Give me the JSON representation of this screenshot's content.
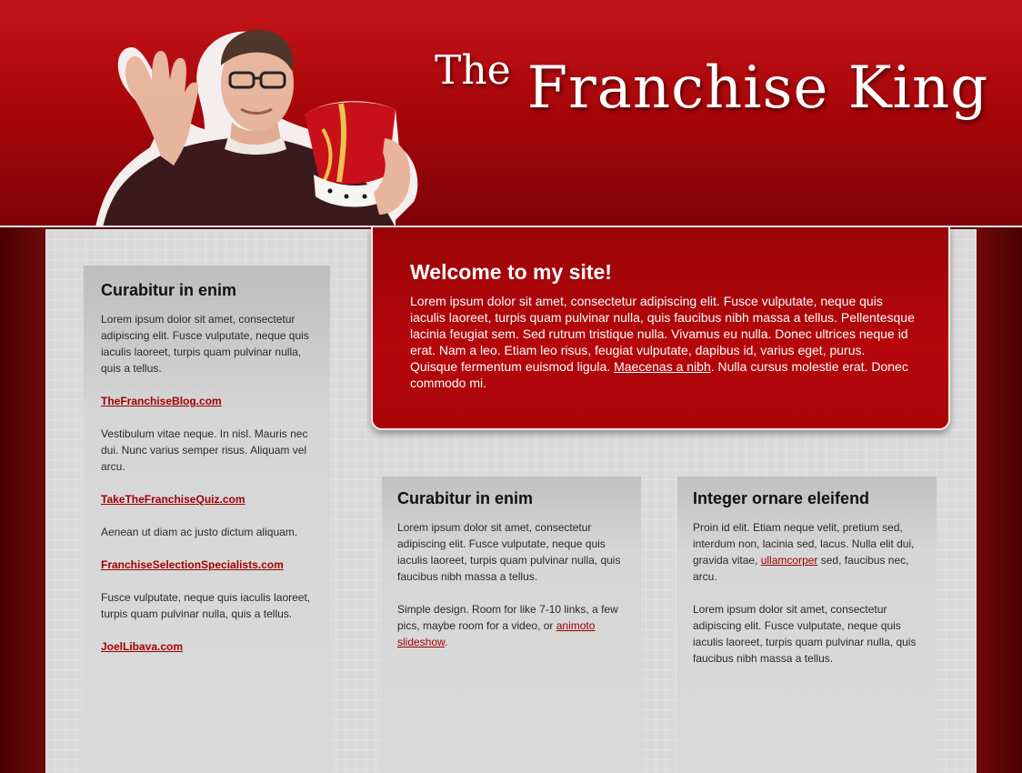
{
  "header": {
    "title_the": "The",
    "title_main": "Franchise King"
  },
  "welcome": {
    "heading": "Welcome to my site!",
    "text_before_link": "Lorem ipsum dolor sit amet, consectetur adipiscing elit. Fusce vulputate, neque quis iaculis laoreet, turpis quam pulvinar nulla, quis faucibus nibh massa a tellus. Pellentesque lacinia feugiat sem. Sed rutrum tristique nulla. Vivamus eu nulla. Donec ultrices neque id erat. Nam a leo. Etiam leo risus, feugiat vulputate, dapibus id, varius eget, purus. Quisque fermentum euismod ligula. ",
    "link_label": "Maecenas a nibh",
    "text_after_link": ". Nulla cursus molestie erat. Donec commodo mi."
  },
  "sidebar": {
    "title": "Curabitur in enim",
    "intro": "Lorem ipsum dolor sit amet, consectetur adipiscing elit. Fusce vulputate, neque quis iaculis laoreet, turpis quam pulvinar nulla, quis a tellus.",
    "link1": "TheFranchiseBlog.com",
    "text1": "Vestibulum vitae neque. In nisl. Mauris nec dui. Nunc varius semper risus. Aliquam vel arcu.",
    "link2": "TakeTheFranchiseQuiz.com",
    "text2": "Aenean ut diam ac justo dictum aliquam.",
    "link3": "FranchiseSelectionSpecialists.com",
    "text3": "Fusce vulputate, neque quis iaculis laoreet, turpis quam pulvinar nulla, quis a tellus.",
    "link4": "JoelLibava.com"
  },
  "col1": {
    "title": "Curabitur in enim",
    "para1": "Lorem ipsum dolor sit amet, consectetur adipiscing elit. Fusce vulputate, neque quis iaculis laoreet, turpis quam pulvinar nulla, quis faucibus nibh massa a tellus.",
    "para2_text": "Simple design. Room for like 7-10 links, a few pics, maybe room for a video, or ",
    "para2_link": "animoto slideshow",
    "para2_end": "."
  },
  "col2": {
    "title": "Integer ornare eleifend",
    "para1_text": "Proin id elit. Etiam neque velit, pretium sed, interdum non, lacinia sed, lacus. Nulla elit dui, gravida vitae, ",
    "para1_link": "ullamcorper",
    "para1_end": " sed, faucibus nec, arcu.",
    "para2": "Lorem ipsum dolor sit amet, consectetur adipiscing elit. Fusce vulputate, neque quis iaculis laoreet, turpis quam pulvinar nulla, quis faucibus nibh massa a tellus."
  },
  "colors": {
    "header_red": "#b0060b",
    "link_red": "#a00000",
    "panel_gray": "#dadada",
    "side_dark": "#5a0000"
  },
  "icons": {
    "portrait": "man-holding-crown-illustration"
  }
}
